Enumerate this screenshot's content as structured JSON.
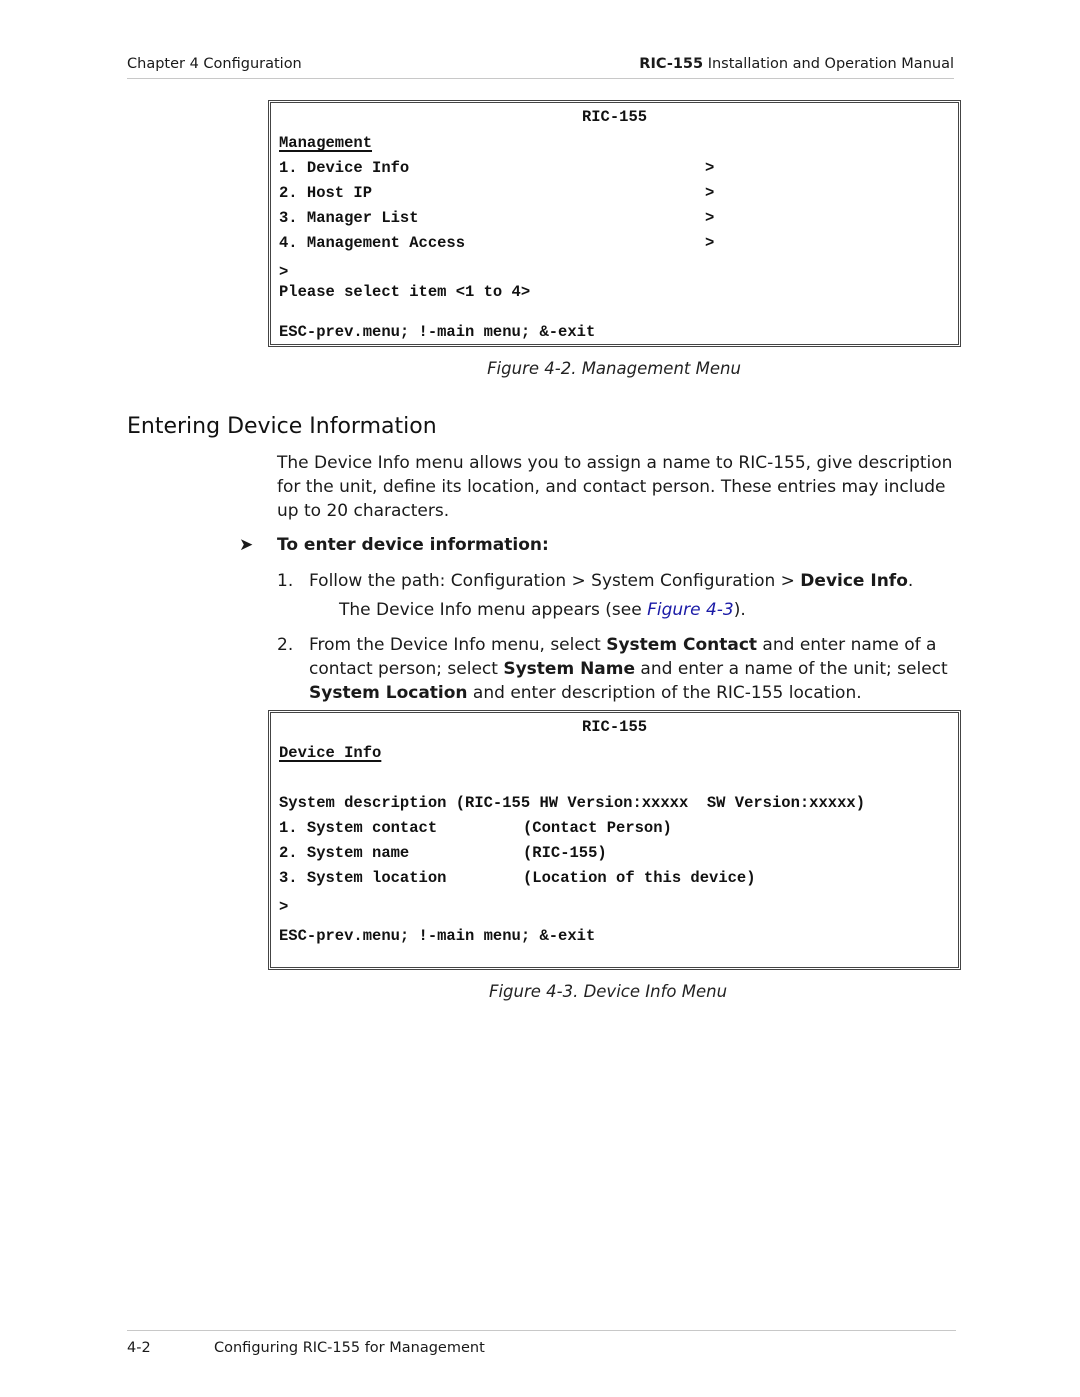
{
  "header": {
    "chapter": "Chapter 4  Configuration",
    "manual_product": "RIC-155",
    "manual_title": " Installation and Operation Manual"
  },
  "figure_4_2": {
    "terminal": {
      "title": "RIC-155",
      "menu_name": "Management",
      "items": [
        {
          "label": "1. Device Info",
          "arrow": ">"
        },
        {
          "label": "2. Host IP",
          "arrow": ">"
        },
        {
          "label": "3. Manager List",
          "arrow": ">"
        },
        {
          "label": "4. Management Access",
          "arrow": ">"
        }
      ],
      "prompt": ">",
      "instruction": "Please select item <1 to 4>",
      "footer": "ESC-prev.menu; !-main menu; &-exit"
    },
    "caption": "Figure 4-2.  Management Menu"
  },
  "section": {
    "heading": "Entering Device Information",
    "intro": "The Device Info menu allows you to assign a name to RIC-155, give description for the unit, define its location, and contact person. These entries may include up to 20 characters.",
    "procedure_title": "To enter device information:",
    "steps": [
      {
        "number": "1.",
        "text_before": "Follow the path: Configuration > System Configuration > ",
        "bold": "Device Info",
        "text_after": ".",
        "note_before": "The Device Info menu appears (see ",
        "note_link": "Figure 4-3",
        "note_after": ")."
      },
      {
        "number": "2.",
        "t1": "From the Device Info menu, select ",
        "b1": "System Contact",
        "t2": " and enter name of a contact person; select ",
        "b2": "System Name",
        "t3": " and enter a name of the unit; select ",
        "b3": "System Location",
        "t4": " and enter description of the RIC-155 location."
      }
    ]
  },
  "figure_4_3": {
    "terminal": {
      "title": "RIC-155",
      "menu_name": "Device Info",
      "description_line": "System description (RIC-155 HW Version:xxxxx  SW Version:xxxxx)",
      "items": [
        {
          "label": "1. System contact",
          "value": "(Contact Person)"
        },
        {
          "label": "2. System name",
          "value": "(RIC-155)"
        },
        {
          "label": "3. System location",
          "value": "(Location of this device)"
        }
      ],
      "prompt": ">",
      "footer": "ESC-prev.menu; !-main menu; &-exit"
    },
    "caption": "Figure 4-3.  Device Info Menu"
  },
  "footer": {
    "page_number": "4-2",
    "section_title": "Configuring RIC-155 for Management"
  }
}
